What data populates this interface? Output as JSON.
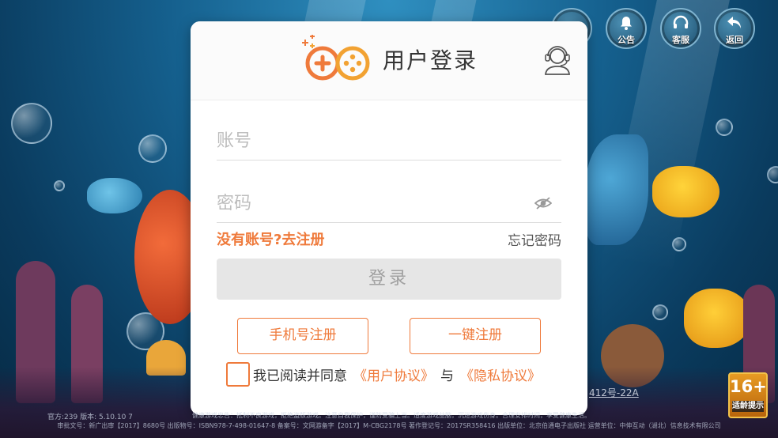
{
  "header": {
    "title": "用户登录",
    "service_icon": "headset-service-icon",
    "logo_icon": "gamepad-logo-icon"
  },
  "top_buttons": [
    {
      "label": "公告",
      "icon": "bell-icon"
    },
    {
      "label": "客服",
      "icon": "headset-icon"
    },
    {
      "label": "返回",
      "icon": "back-arrow-icon"
    }
  ],
  "form": {
    "account_placeholder": "账号",
    "account_value": "",
    "password_placeholder": "密码",
    "password_value": "",
    "password_toggle_icon": "eye-icon",
    "register_link": "没有账号?去注册",
    "forgot_link": "忘记密码",
    "login_button": "登录",
    "phone_register_button": "手机号注册",
    "quick_register_button": "一键注册"
  },
  "agreement": {
    "checked": false,
    "text": "我已阅读并同意",
    "user_agreement": "《用户协议》",
    "and": "与",
    "privacy_policy": "《隐私协议》"
  },
  "footer": {
    "version": "官方:239  版本: 5.10.10 7",
    "line1": "健康游戏忠告：抵制不良游戏，拒绝盗版游戏。注意自我保护，谨防受骗上当。适度游戏益脑，沉迷游戏伤身。合理安排时间，享受健康生活。",
    "line2": "审批文号：新广出审【2017】8680号 出版物号：ISBN978-7-498-01647-8 备案号：文网游备字【2017】M-CBG2178号 著作登记号：2017SR358416 出版单位：北京伯通电子出版社 运营单位：中伸互动（湖北）信息技术有限公司",
    "reg_number": "412号-22A"
  },
  "age_rating": {
    "value": "16+",
    "label": "适龄提示"
  },
  "colors": {
    "accent": "#ef7a3b",
    "login_disabled_bg": "#e6e6e6",
    "login_disabled_text": "#a0a0a0"
  }
}
